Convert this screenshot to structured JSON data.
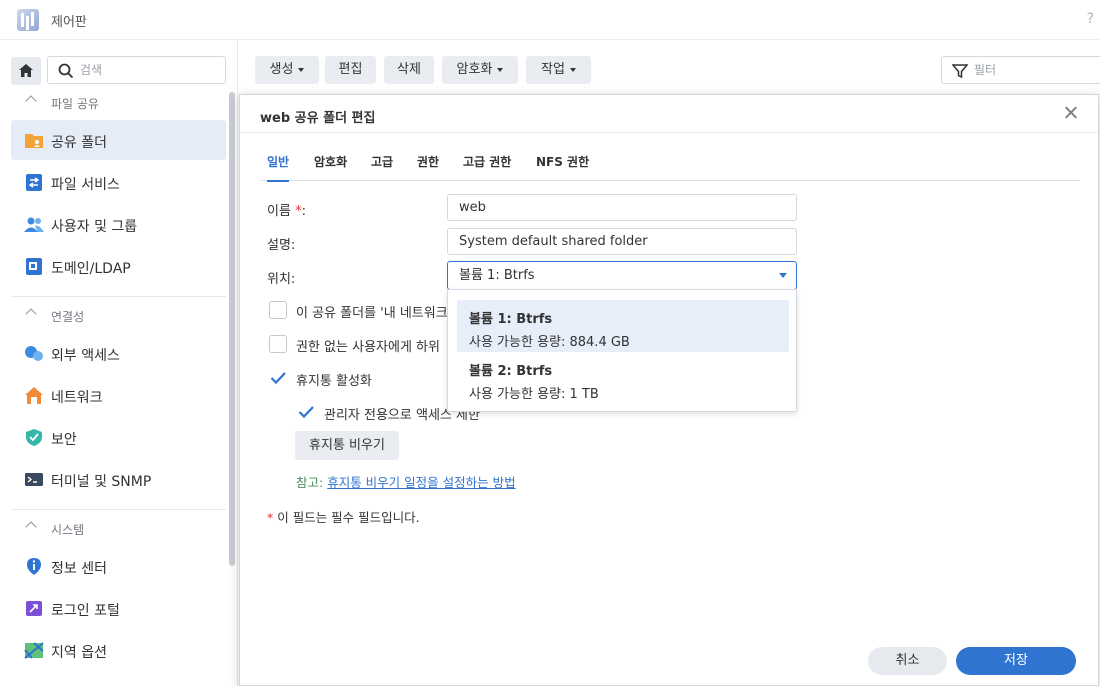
{
  "window": {
    "title": "제어판",
    "help_glyph": "?"
  },
  "sidebar": {
    "search_placeholder": "검색",
    "sections": [
      {
        "label": "파일 공유",
        "items": [
          {
            "label": "공유 폴더",
            "icon": "shared-folder-icon",
            "active": true
          },
          {
            "label": "파일 서비스",
            "icon": "file-services-icon"
          },
          {
            "label": "사용자 및 그룹",
            "icon": "users-groups-icon"
          },
          {
            "label": "도메인/LDAP",
            "icon": "domain-ldap-icon"
          }
        ]
      },
      {
        "label": "연결성",
        "items": [
          {
            "label": "외부 액세스",
            "icon": "external-access-icon"
          },
          {
            "label": "네트워크",
            "icon": "network-icon"
          },
          {
            "label": "보안",
            "icon": "security-shield-icon"
          },
          {
            "label": "터미널 및 SNMP",
            "icon": "terminal-icon"
          }
        ]
      },
      {
        "label": "시스템",
        "items": [
          {
            "label": "정보 센터",
            "icon": "info-center-icon"
          },
          {
            "label": "로그인 포털",
            "icon": "login-portal-icon"
          },
          {
            "label": "지역 옵션",
            "icon": "regional-options-icon"
          }
        ]
      }
    ]
  },
  "toolbar": {
    "create": "생성",
    "edit": "편집",
    "delete": "삭제",
    "encryption": "암호화",
    "action": "작업",
    "filter_placeholder": "필터"
  },
  "dialog": {
    "title": "web 공유 폴더 편집",
    "tabs": [
      "일반",
      "암호화",
      "고급",
      "권한",
      "고급 권한",
      "NFS 권한"
    ],
    "active_tab": "일반",
    "fields": {
      "name_label": "이름 ",
      "name_req": "*",
      "name_colon": ":",
      "name_value": "web",
      "desc_label": "설명:",
      "desc_value": "System default shared folder",
      "location_label": "위치:",
      "location_value": "볼륨 1:  Btrfs"
    },
    "options": {
      "hide_network_places": "이 공유 폴더를 '내 네트워크",
      "hide_subfolders": "권한 없는 사용자에게 하위",
      "recycle_bin": "휴지통 활성화",
      "admin_only": "관리자 전용으로 액세스 제한"
    },
    "empty_recycle_bin": "휴지통 비우기",
    "note_prefix": "참고: ",
    "note_link": "휴지통 비우기 일정을 설정하는 방법",
    "required_star": "*",
    "required_note": " 이 필드는 필수 필드입니다.",
    "cancel": "취소",
    "save": "저장"
  },
  "location_dropdown": [
    {
      "title": "볼륨 1: Btrfs",
      "subtitle": "사용 가능한 용량: 884.4 GB",
      "selected": true
    },
    {
      "title": "볼륨 2: Btrfs",
      "subtitle": "사용 가능한 용량: 1 TB",
      "selected": false
    }
  ],
  "colors": {
    "accent": "#2f74d0",
    "required": "#e4312d",
    "note": "#4d8f5f"
  }
}
